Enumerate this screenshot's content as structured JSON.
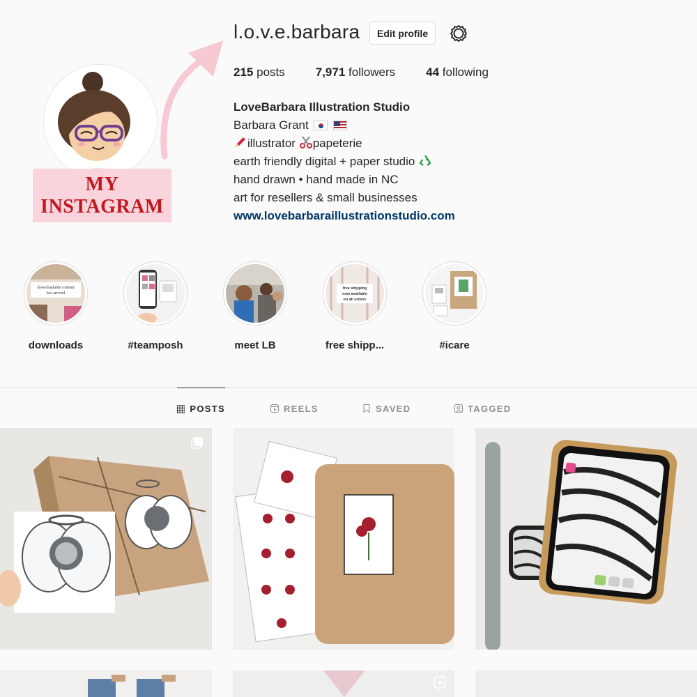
{
  "profile": {
    "username": "l.o.v.e.barbara",
    "edit_label": "Edit profile",
    "promo_line1": "MY",
    "promo_line2": "INSTAGRAM"
  },
  "stats": {
    "posts_count": "215",
    "posts_label": "posts",
    "followers_count": "7,971",
    "followers_label": "followers",
    "following_count": "44",
    "following_label": "following"
  },
  "bio": {
    "name": "LoveBarbara Illustration Studio",
    "line1": "Barbara Grant",
    "line2a": "illustrator",
    "line2b": "papeterie",
    "line3": "earth friendly digital + paper studio",
    "line4": "hand drawn • hand made in NC",
    "line5": "art for resellers & small businesses",
    "link": "www.lovebarbaraillustrationstudio.com"
  },
  "highlights": [
    {
      "label": "downloads",
      "thumb_text": "downloadable content has arrived"
    },
    {
      "label": "#teamposh"
    },
    {
      "label": "meet LB"
    },
    {
      "label": "free shipp...",
      "thumb_text": "free shipping now available on all orders"
    },
    {
      "label": "#icare"
    }
  ],
  "tabs": {
    "posts": "POSTS",
    "reels": "REELS",
    "saved": "SAVED",
    "tagged": "TAGGED"
  },
  "colors": {
    "link": "#00376b",
    "promo_bg": "#f9d4dd",
    "promo_text": "#c4161c",
    "arrow": "#f6c9d3"
  }
}
